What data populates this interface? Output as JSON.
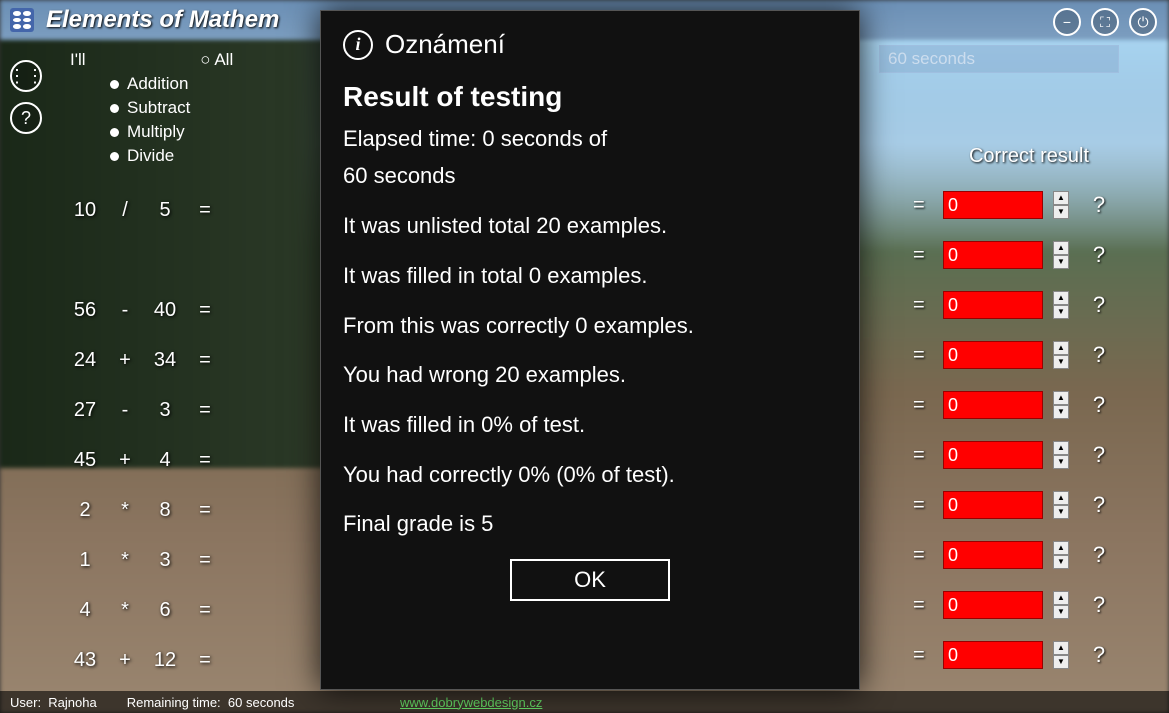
{
  "app": {
    "title": "Elements of Mathem"
  },
  "window": {
    "minimize": "−",
    "maximize": "⛶",
    "close": "⏻"
  },
  "sidebar": {
    "menu": "⋮⋮",
    "help": "?"
  },
  "ops": {
    "ill": "I'll",
    "all": "All",
    "items": [
      "Addition",
      "Subtract",
      "Multiply",
      "Divide"
    ]
  },
  "timer": {
    "text": "60 seconds"
  },
  "correct_header": "Correct result",
  "examples": [
    {
      "a": "10",
      "op": "/",
      "b": "5",
      "eq": "="
    },
    {
      "a": "",
      "op": "",
      "b": "",
      "eq": ""
    },
    {
      "a": "56",
      "op": "-",
      "b": "40",
      "eq": "="
    },
    {
      "a": "24",
      "op": "+",
      "b": "34",
      "eq": "="
    },
    {
      "a": "27",
      "op": "-",
      "b": "3",
      "eq": "="
    },
    {
      "a": "45",
      "op": "+",
      "b": "4",
      "eq": "="
    },
    {
      "a": "2",
      "op": "*",
      "b": "8",
      "eq": "="
    },
    {
      "a": "1",
      "op": "*",
      "b": "3",
      "eq": "="
    },
    {
      "a": "4",
      "op": "*",
      "b": "6",
      "eq": "="
    },
    {
      "a": "43",
      "op": "+",
      "b": "12",
      "eq": "="
    }
  ],
  "answers": [
    {
      "eq": "=",
      "val": "0",
      "q": "?"
    },
    {
      "eq": "=",
      "val": "0",
      "q": "?"
    },
    {
      "eq": "=",
      "val": "0",
      "q": "?"
    },
    {
      "eq": "=",
      "val": "0",
      "q": "?"
    },
    {
      "eq": "=",
      "val": "0",
      "q": "?"
    },
    {
      "eq": "=",
      "val": "0",
      "q": "?"
    },
    {
      "eq": "=",
      "val": "0",
      "q": "?"
    },
    {
      "eq": "=",
      "val": "0",
      "q": "?"
    },
    {
      "eq": "=",
      "val": "0",
      "q": "?"
    },
    {
      "eq": "=",
      "val": "0",
      "q": "?"
    }
  ],
  "status": {
    "user_label": "User:",
    "user_value": "Rajnoha",
    "remain_label": "Remaining time:",
    "remain_value": "60 seconds",
    "link": "www.dobrywebdesign.cz"
  },
  "modal": {
    "header": "Oznámení",
    "title": "Result of testing",
    "elapsed1": "Elapsed time: 0 seconds of",
    "elapsed2": " 60 seconds",
    "lines": [
      "It was unlisted total 20 examples.",
      "It was filled in total 0 examples.",
      "From this was correctly 0 examples.",
      "You had wrong 20 examples.",
      "It was filled in 0% of test.",
      "You had correctly 0% (0% of test).",
      "Final grade is 5"
    ],
    "ok": "OK"
  }
}
